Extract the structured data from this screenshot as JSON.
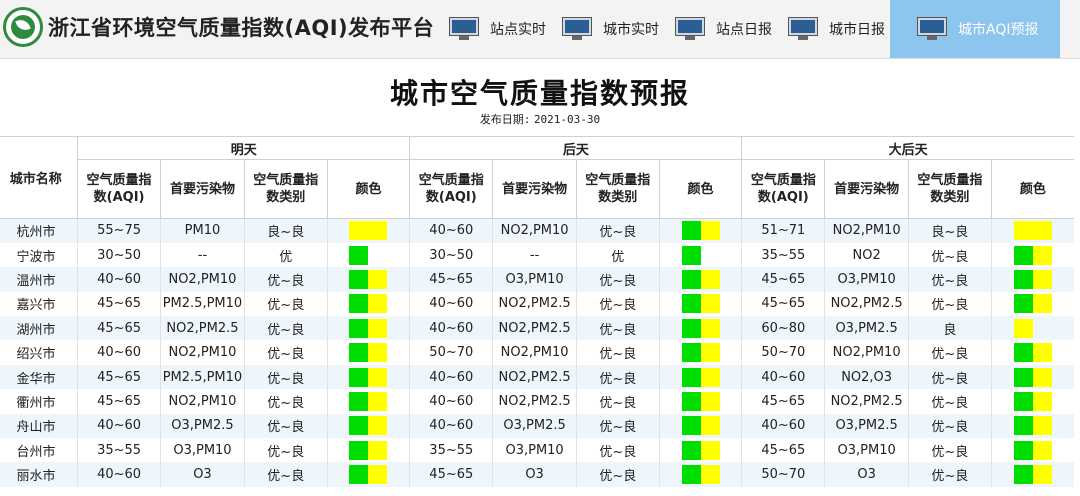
{
  "header": {
    "site_title": "浙江省环境空气质量指数(AQI)发布平台",
    "nav": [
      {
        "label": "站点实时",
        "active": false
      },
      {
        "label": "城市实时",
        "active": false
      },
      {
        "label": "站点日报",
        "active": false
      },
      {
        "label": "城市日报",
        "active": false
      },
      {
        "label": "城市AQI预报",
        "active": true
      }
    ]
  },
  "page": {
    "title": "城市空气质量指数预报",
    "publish_label": "发布日期:",
    "publish_date": "2021-03-30"
  },
  "colors": {
    "优": "#00dd00",
    "良": "#ffff00"
  },
  "table": {
    "city_header": "城市名称",
    "days": [
      "明天",
      "后天",
      "大后天"
    ],
    "subheaders": [
      "空气质量指数(AQI)",
      "首要污染物",
      "空气质量指数类别",
      "颜色"
    ],
    "rows": [
      {
        "city": "杭州市",
        "d": [
          {
            "aqi": "55~75",
            "pollutant": "PM10",
            "category": "良~良"
          },
          {
            "aqi": "40~60",
            "pollutant": "NO2,PM10",
            "category": "优~良"
          },
          {
            "aqi": "51~71",
            "pollutant": "NO2,PM10",
            "category": "良~良"
          }
        ]
      },
      {
        "city": "宁波市",
        "d": [
          {
            "aqi": "30~50",
            "pollutant": "--",
            "category": "优"
          },
          {
            "aqi": "30~50",
            "pollutant": "--",
            "category": "优"
          },
          {
            "aqi": "35~55",
            "pollutant": "NO2",
            "category": "优~良"
          }
        ]
      },
      {
        "city": "温州市",
        "d": [
          {
            "aqi": "40~60",
            "pollutant": "NO2,PM10",
            "category": "优~良"
          },
          {
            "aqi": "45~65",
            "pollutant": "O3,PM10",
            "category": "优~良"
          },
          {
            "aqi": "45~65",
            "pollutant": "O3,PM10",
            "category": "优~良"
          }
        ]
      },
      {
        "city": "嘉兴市",
        "d": [
          {
            "aqi": "45~65",
            "pollutant": "PM2.5,PM10",
            "category": "优~良"
          },
          {
            "aqi": "40~60",
            "pollutant": "NO2,PM2.5",
            "category": "优~良"
          },
          {
            "aqi": "45~65",
            "pollutant": "NO2,PM2.5",
            "category": "优~良"
          }
        ]
      },
      {
        "city": "湖州市",
        "d": [
          {
            "aqi": "45~65",
            "pollutant": "NO2,PM2.5",
            "category": "优~良"
          },
          {
            "aqi": "40~60",
            "pollutant": "NO2,PM2.5",
            "category": "优~良"
          },
          {
            "aqi": "60~80",
            "pollutant": "O3,PM2.5",
            "category": "良"
          }
        ]
      },
      {
        "city": "绍兴市",
        "d": [
          {
            "aqi": "40~60",
            "pollutant": "NO2,PM10",
            "category": "优~良"
          },
          {
            "aqi": "50~70",
            "pollutant": "NO2,PM10",
            "category": "优~良"
          },
          {
            "aqi": "50~70",
            "pollutant": "NO2,PM10",
            "category": "优~良"
          }
        ]
      },
      {
        "city": "金华市",
        "d": [
          {
            "aqi": "45~65",
            "pollutant": "PM2.5,PM10",
            "category": "优~良"
          },
          {
            "aqi": "40~60",
            "pollutant": "NO2,PM2.5",
            "category": "优~良"
          },
          {
            "aqi": "40~60",
            "pollutant": "NO2,O3",
            "category": "优~良"
          }
        ]
      },
      {
        "city": "衢州市",
        "d": [
          {
            "aqi": "45~65",
            "pollutant": "NO2,PM10",
            "category": "优~良"
          },
          {
            "aqi": "40~60",
            "pollutant": "NO2,PM2.5",
            "category": "优~良"
          },
          {
            "aqi": "45~65",
            "pollutant": "NO2,PM2.5",
            "category": "优~良"
          }
        ]
      },
      {
        "city": "舟山市",
        "d": [
          {
            "aqi": "40~60",
            "pollutant": "O3,PM2.5",
            "category": "优~良"
          },
          {
            "aqi": "40~60",
            "pollutant": "O3,PM2.5",
            "category": "优~良"
          },
          {
            "aqi": "40~60",
            "pollutant": "O3,PM2.5",
            "category": "优~良"
          }
        ]
      },
      {
        "city": "台州市",
        "d": [
          {
            "aqi": "35~55",
            "pollutant": "O3,PM10",
            "category": "优~良"
          },
          {
            "aqi": "35~55",
            "pollutant": "O3,PM10",
            "category": "优~良"
          },
          {
            "aqi": "45~65",
            "pollutant": "O3,PM10",
            "category": "优~良"
          }
        ]
      },
      {
        "city": "丽水市",
        "d": [
          {
            "aqi": "40~60",
            "pollutant": "O3",
            "category": "优~良"
          },
          {
            "aqi": "45~65",
            "pollutant": "O3",
            "category": "优~良"
          },
          {
            "aqi": "50~70",
            "pollutant": "O3",
            "category": "优~良"
          }
        ]
      }
    ]
  }
}
